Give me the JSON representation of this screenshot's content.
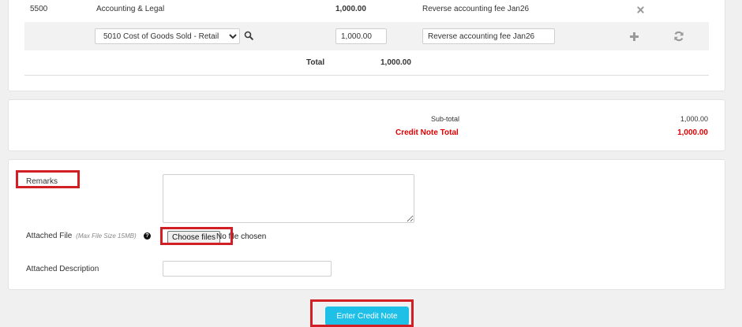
{
  "lines": {
    "row1": {
      "account_code": "5500",
      "account_name": "Accounting & Legal",
      "amount": "1,000.00",
      "description": "Reverse accounting fee Jan26"
    },
    "edit": {
      "account_select": "5010    Cost of Goods Sold - Retail",
      "account_options": [
        "5010    Cost of Goods Sold - Retail"
      ],
      "amount_value": "1,000.00",
      "description_value": "Reverse accounting fee Jan26"
    },
    "total_label": "Total",
    "total_value": "1,000.00"
  },
  "summary": {
    "subtotal_label": "Sub-total",
    "subtotal_value": "1,000.00",
    "credit_total_label": "Credit Note Total",
    "credit_total_value": "1,000.00",
    "accent_color": "#e00000"
  },
  "form": {
    "remarks_label": "Remarks",
    "remarks_value": "",
    "attached_file_label": "Attached File",
    "attached_file_hint": "(Max File Size 15MB)",
    "help_glyph": "?",
    "choose_files_label": "Choose files",
    "no_file_text": "No file chosen",
    "attached_description_label": "Attached Description",
    "attached_description_value": ""
  },
  "actions": {
    "enter_credit_note_label": "Enter Credit Note",
    "button_color": "#1fc0e8"
  },
  "icons": {
    "remove": "close-icon",
    "search": "search-icon",
    "add": "plus-icon",
    "refresh": "refresh-icon"
  },
  "highlight_color": "#d21f26"
}
